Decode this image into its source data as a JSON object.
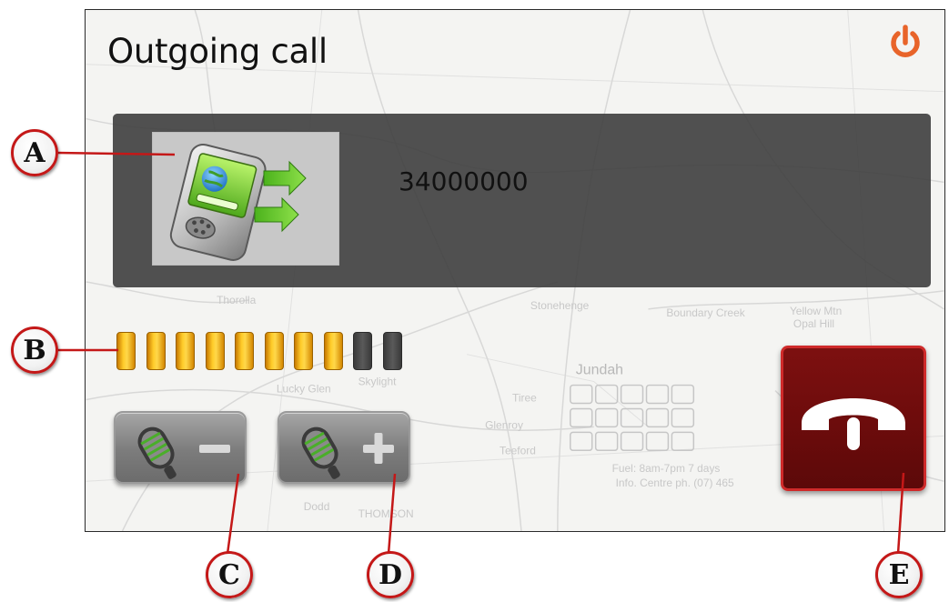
{
  "screen": {
    "title": "Outgoing call",
    "power_icon": "power-icon"
  },
  "caller": {
    "image_icon": "pda-phone-globe-icon",
    "number": "34000000"
  },
  "volume": {
    "segments_total": 10,
    "segments_active": 8,
    "active_color": "#ffcc2a",
    "inactive_color": "#4a4a4a"
  },
  "buttons": {
    "mic_down_icon": "microphone-minus-icon",
    "mic_up_icon": "microphone-plus-icon",
    "hangup_icon": "phone-hangup-icon",
    "hangup_color": "#6e0c0c"
  },
  "callouts": {
    "a": "A",
    "b": "B",
    "c": "C",
    "d": "D",
    "e": "E"
  },
  "map": {
    "town": "Jundah",
    "labels": [
      "Thorolla",
      "Boundary Creek",
      "Yellow Mtn",
      "Opal Hill",
      "Stonehenge",
      "Skylight",
      "Lucky Glen",
      "Tiree",
      "Glenroy",
      "Teeford",
      "Fuel: 8am-7pm 7 days",
      "Info. Centre ph. (07) 465",
      "THOMSON",
      "Dodd"
    ],
    "accent": "#e8642a"
  }
}
